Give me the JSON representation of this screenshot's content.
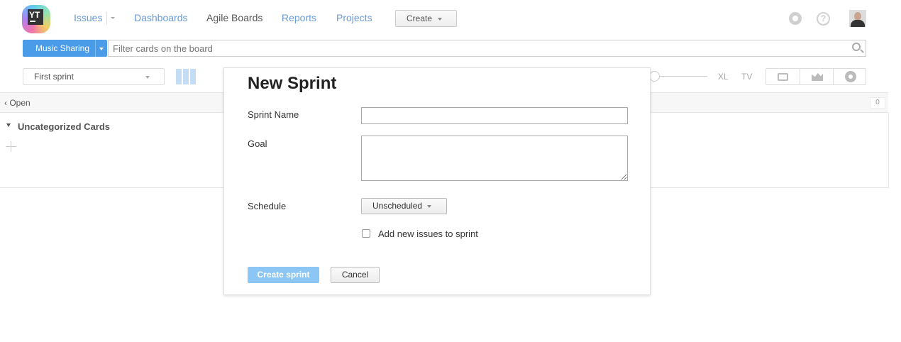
{
  "app": {
    "logo_text": "YT"
  },
  "nav": {
    "issues": "Issues",
    "dashboards": "Dashboards",
    "agile_boards": "Agile Boards",
    "reports": "Reports",
    "projects": "Projects",
    "create": "Create",
    "help": "?"
  },
  "board": {
    "name": "Music Sharing",
    "search_placeholder": "Filter cards on the board",
    "sprint": "First sprint",
    "size_xl": "XL",
    "size_tv": "TV",
    "column_open": "Open",
    "column_count": "0",
    "swimlane_title": "Uncategorized Cards"
  },
  "dialog": {
    "title": "New Sprint",
    "sprint_name_label": "Sprint Name",
    "sprint_name_value": "",
    "goal_label": "Goal",
    "goal_value": "",
    "schedule_label": "Schedule",
    "schedule_value": "Unscheduled",
    "add_issues_label": "Add new issues to sprint",
    "add_issues_checked": false,
    "create_button": "Create sprint",
    "cancel_button": "Cancel"
  },
  "colors": {
    "accent": "#4a9be8",
    "link": "#6b9ad8",
    "create_disabled": "#8cc6f5"
  }
}
